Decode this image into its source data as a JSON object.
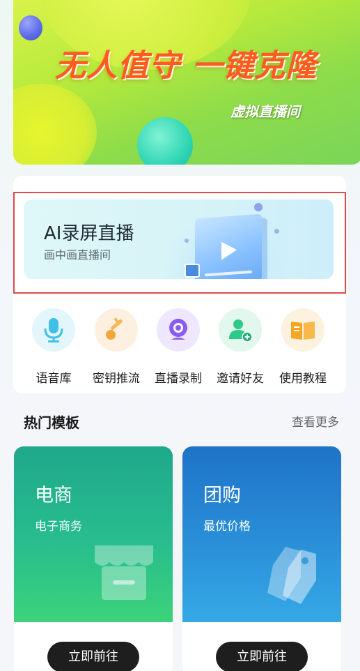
{
  "banner": {
    "title": "无人值守 一键克隆",
    "subtitle": "虚拟直播间"
  },
  "ai_card": {
    "title": "AI录屏直播",
    "subtitle": "画中画直播间"
  },
  "tools": [
    {
      "label": "语音库",
      "icon": "microphone-icon",
      "color": "#3fc0e8"
    },
    {
      "label": "密钥推流",
      "icon": "key-icon",
      "color": "#f3a53a"
    },
    {
      "label": "直播录制",
      "icon": "webcam-icon",
      "color": "#8a5cf0"
    },
    {
      "label": "邀请好友",
      "icon": "add-user-icon",
      "color": "#2fc98a"
    },
    {
      "label": "使用教程",
      "icon": "book-icon",
      "color": "#f6a623"
    }
  ],
  "section": {
    "title": "热门模板",
    "more": "查看更多"
  },
  "templates": [
    {
      "name": "电商",
      "desc": "电子商务",
      "button": "立即前往",
      "icon": "storefront-icon"
    },
    {
      "name": "团购",
      "desc": "最优价格",
      "button": "立即前往",
      "icon": "price-tag-icon"
    }
  ]
}
